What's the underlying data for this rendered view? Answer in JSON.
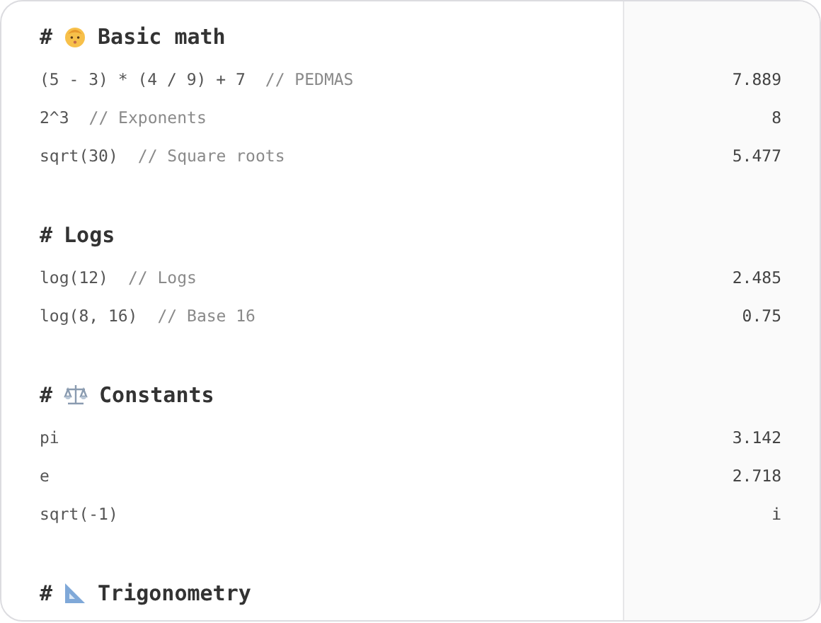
{
  "lines": [
    {
      "kind": "face-heading",
      "hash": "#",
      "title": "Basic math"
    },
    {
      "kind": "expr",
      "expr": "(5 - 3) * (4 / 9) + 7",
      "comment": "// PEDMAS",
      "result": "7.889"
    },
    {
      "kind": "expr",
      "expr": "2^3",
      "comment": "// Exponents",
      "result": "8"
    },
    {
      "kind": "expr",
      "expr": "sqrt(30)",
      "comment": "// Square roots",
      "result": "5.477"
    },
    {
      "kind": "blank"
    },
    {
      "kind": "heading",
      "hash": "#",
      "title": "Logs"
    },
    {
      "kind": "expr",
      "expr": "log(12)",
      "comment": "// Logs",
      "result": "2.485"
    },
    {
      "kind": "expr",
      "expr": "log(8, 16)",
      "comment": "// Base 16",
      "result": "0.75"
    },
    {
      "kind": "blank"
    },
    {
      "kind": "scales-heading",
      "hash": "#",
      "title": "Constants"
    },
    {
      "kind": "expr",
      "expr": "pi",
      "result": "3.142"
    },
    {
      "kind": "expr",
      "expr": "e",
      "result": "2.718"
    },
    {
      "kind": "expr",
      "expr": "sqrt(-1)",
      "result": "i"
    },
    {
      "kind": "blank"
    },
    {
      "kind": "ruler-heading",
      "hash": "#",
      "title": "Trigonometry"
    }
  ]
}
